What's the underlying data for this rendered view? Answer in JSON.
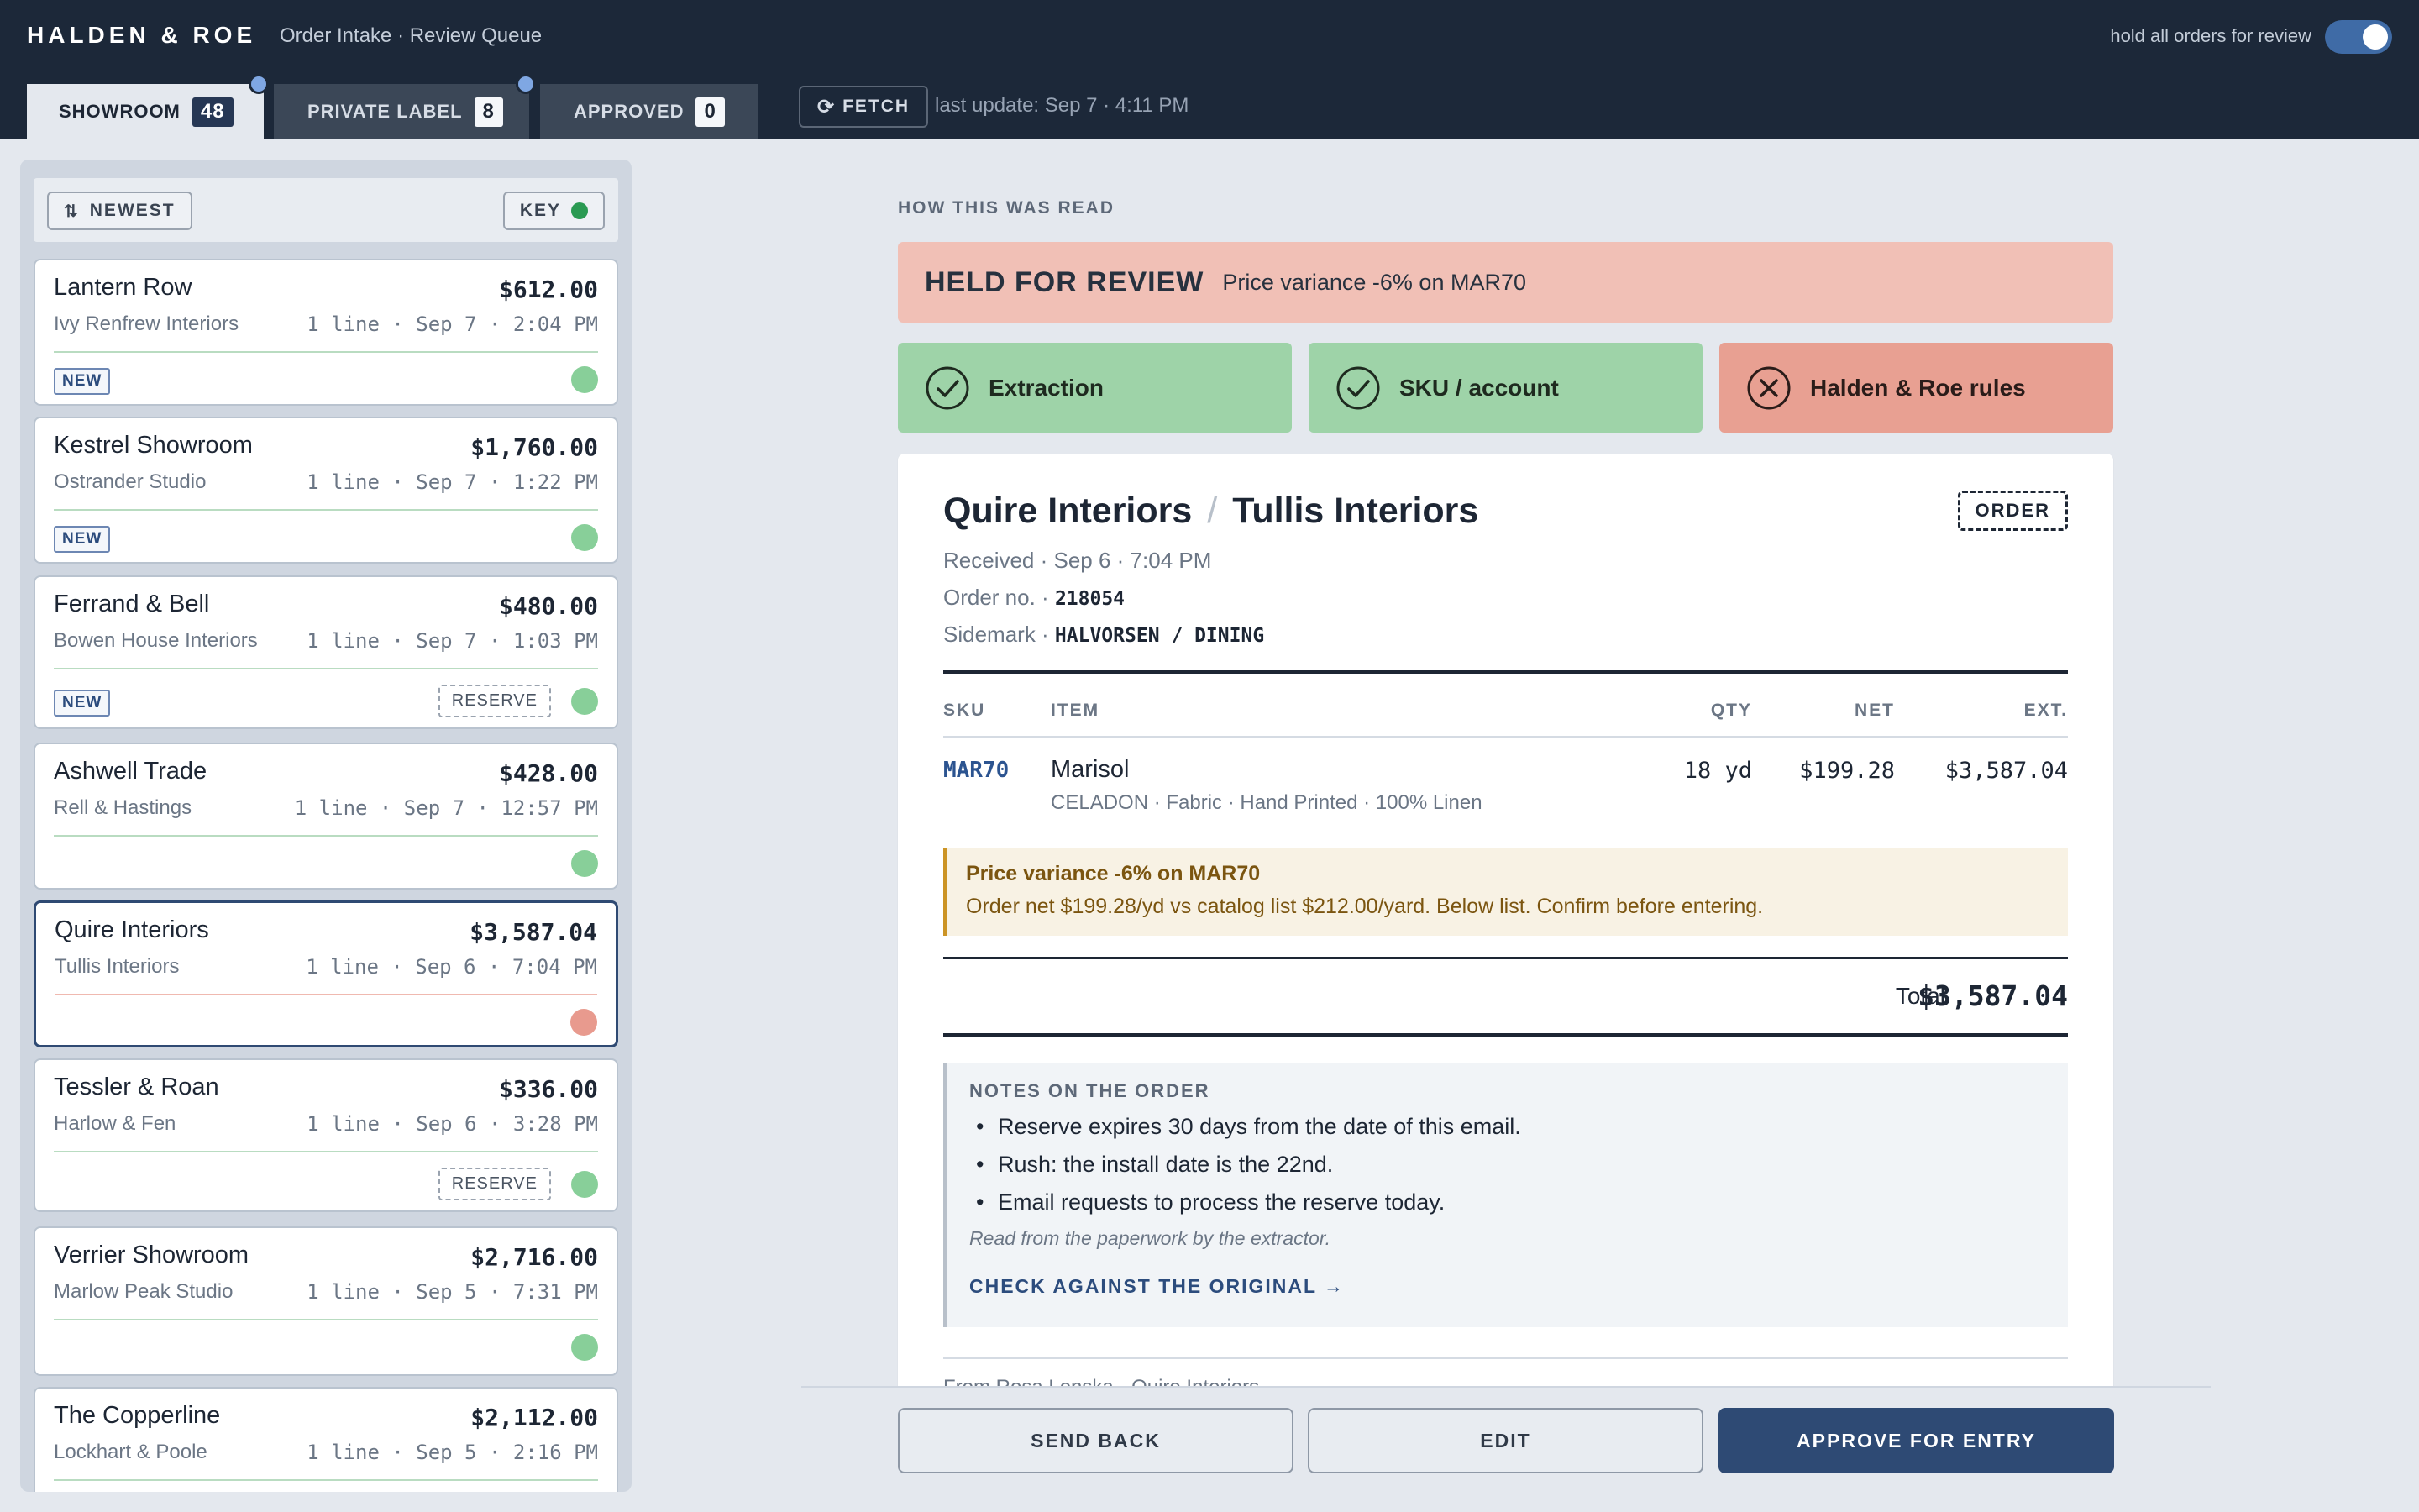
{
  "header": {
    "brand": "HALDEN & ROE",
    "subtitle": "Order Intake · Review Queue",
    "hold_label": "hold all orders for review",
    "hold_toggle_on": true
  },
  "tabs": [
    {
      "label": "SHOWROOM",
      "count": "48",
      "active": true,
      "has_dot": true
    },
    {
      "label": "PRIVATE LABEL",
      "count": "8",
      "active": false,
      "has_dot": true
    },
    {
      "label": "APPROVED",
      "count": "0",
      "active": false,
      "has_dot": false
    }
  ],
  "fetch": {
    "label": "FETCH",
    "icon": "refresh-icon",
    "last_update": "last update: Sep 7 · 4:11 PM"
  },
  "list": {
    "sort_label": "NEWEST",
    "sort_icon": "sort-arrows-icon",
    "key_label": "KEY",
    "key_color": "#2a9a52",
    "orders": [
      {
        "name": "Lantern Row",
        "amount": "$612.00",
        "from": "Ivy Renfrew Interiors",
        "meta": "1 line · Sep 7 · 2:04 PM",
        "badge": "NEW",
        "reserve": "",
        "status": "ok"
      },
      {
        "name": "Kestrel Showroom",
        "amount": "$1,760.00",
        "from": "Ostrander Studio",
        "meta": "1 line · Sep 7 · 1:22 PM",
        "badge": "NEW",
        "reserve": "",
        "status": "ok"
      },
      {
        "name": "Ferrand & Bell",
        "amount": "$480.00",
        "from": "Bowen House Interiors",
        "meta": "1 line · Sep 7 · 1:03 PM",
        "badge": "NEW",
        "reserve": "RESERVE",
        "status": "ok"
      },
      {
        "name": "Ashwell Trade",
        "amount": "$428.00",
        "from": "Rell & Hastings",
        "meta": "1 line · Sep 7 · 12:57 PM",
        "badge": "",
        "reserve": "",
        "status": "ok"
      },
      {
        "name": "Quire Interiors",
        "amount": "$3,587.04",
        "from": "Tullis Interiors",
        "meta": "1 line · Sep 6 · 7:04 PM",
        "badge": "",
        "reserve": "",
        "status": "held",
        "selected": true
      },
      {
        "name": "Tessler & Roan",
        "amount": "$336.00",
        "from": "Harlow & Fen",
        "meta": "1 line · Sep 6 · 3:28 PM",
        "badge": "",
        "reserve": "RESERVE",
        "status": "ok"
      },
      {
        "name": "Verrier Showroom",
        "amount": "$2,716.00",
        "from": "Marlow Peak Studio",
        "meta": "1 line · Sep 5 · 7:31 PM",
        "badge": "",
        "reserve": "",
        "status": "ok"
      },
      {
        "name": "The Copperline",
        "amount": "$2,112.00",
        "from": "Lockhart & Poole",
        "meta": "1 line · Sep 5 · 2:16 PM",
        "badge": "",
        "reserve": "",
        "status": "ok"
      }
    ]
  },
  "detail": {
    "section_label": "HOW THIS WAS READ",
    "held_title": "HELD FOR REVIEW",
    "held_reason": "Price variance -6% on MAR70",
    "checks": [
      {
        "label": "Extraction",
        "result": "pass",
        "icon": "check-circle-icon"
      },
      {
        "label": "SKU / account",
        "result": "pass",
        "icon": "check-circle-icon"
      },
      {
        "label": "Halden & Roe rules",
        "result": "fail",
        "icon": "x-circle-icon"
      }
    ],
    "doc": {
      "customer": "Quire Interiors",
      "separator": "/",
      "ship_to": "Tullis Interiors",
      "tag": "ORDER",
      "received": "Received · Sep 6 · 7:04 PM",
      "order_no_label": "Order no. · ",
      "order_no": "218054",
      "sidemark_label": "Sidemark · ",
      "sidemark": "HALVORSEN / DINING",
      "columns": {
        "sku": "SKU",
        "item": "ITEM",
        "qty": "QTY",
        "net": "NET",
        "ext": "EXT."
      },
      "line": {
        "sku": "MAR70",
        "item": "Marisol",
        "desc": "CELADON · Fabric · Hand Printed · 100% Linen",
        "qty": "18 yd",
        "net": "$199.28",
        "ext": "$3,587.04"
      },
      "variance_title": "Price variance -6% on MAR70",
      "variance_body": "Order net $199.28/yd vs catalog list $212.00/yard. Below list. Confirm before entering.",
      "total_label": "Total",
      "total": "$3,587.04",
      "notes_title": "NOTES ON THE ORDER",
      "notes": [
        "Reserve expires 30 days from the date of this email.",
        "Rush: the install date is the 22nd.",
        "Email requests to process the reserve today."
      ],
      "notes_source": "Read from the paperwork by the extractor.",
      "check_link": "CHECK AGAINST THE ORIGINAL →",
      "from_peek": "From              Rosa Lenska · Quire Interiors"
    },
    "actions": {
      "send_back": "SEND BACK",
      "edit": "EDIT",
      "approve": "APPROVE FOR ENTRY"
    }
  },
  "colors": {
    "topbar": "#1c2839",
    "accent": "#2e4a74",
    "ok": "#88cf99",
    "held": "#e89a8e",
    "held_banner": "#f1c0b6",
    "variance": "#cc9425"
  }
}
